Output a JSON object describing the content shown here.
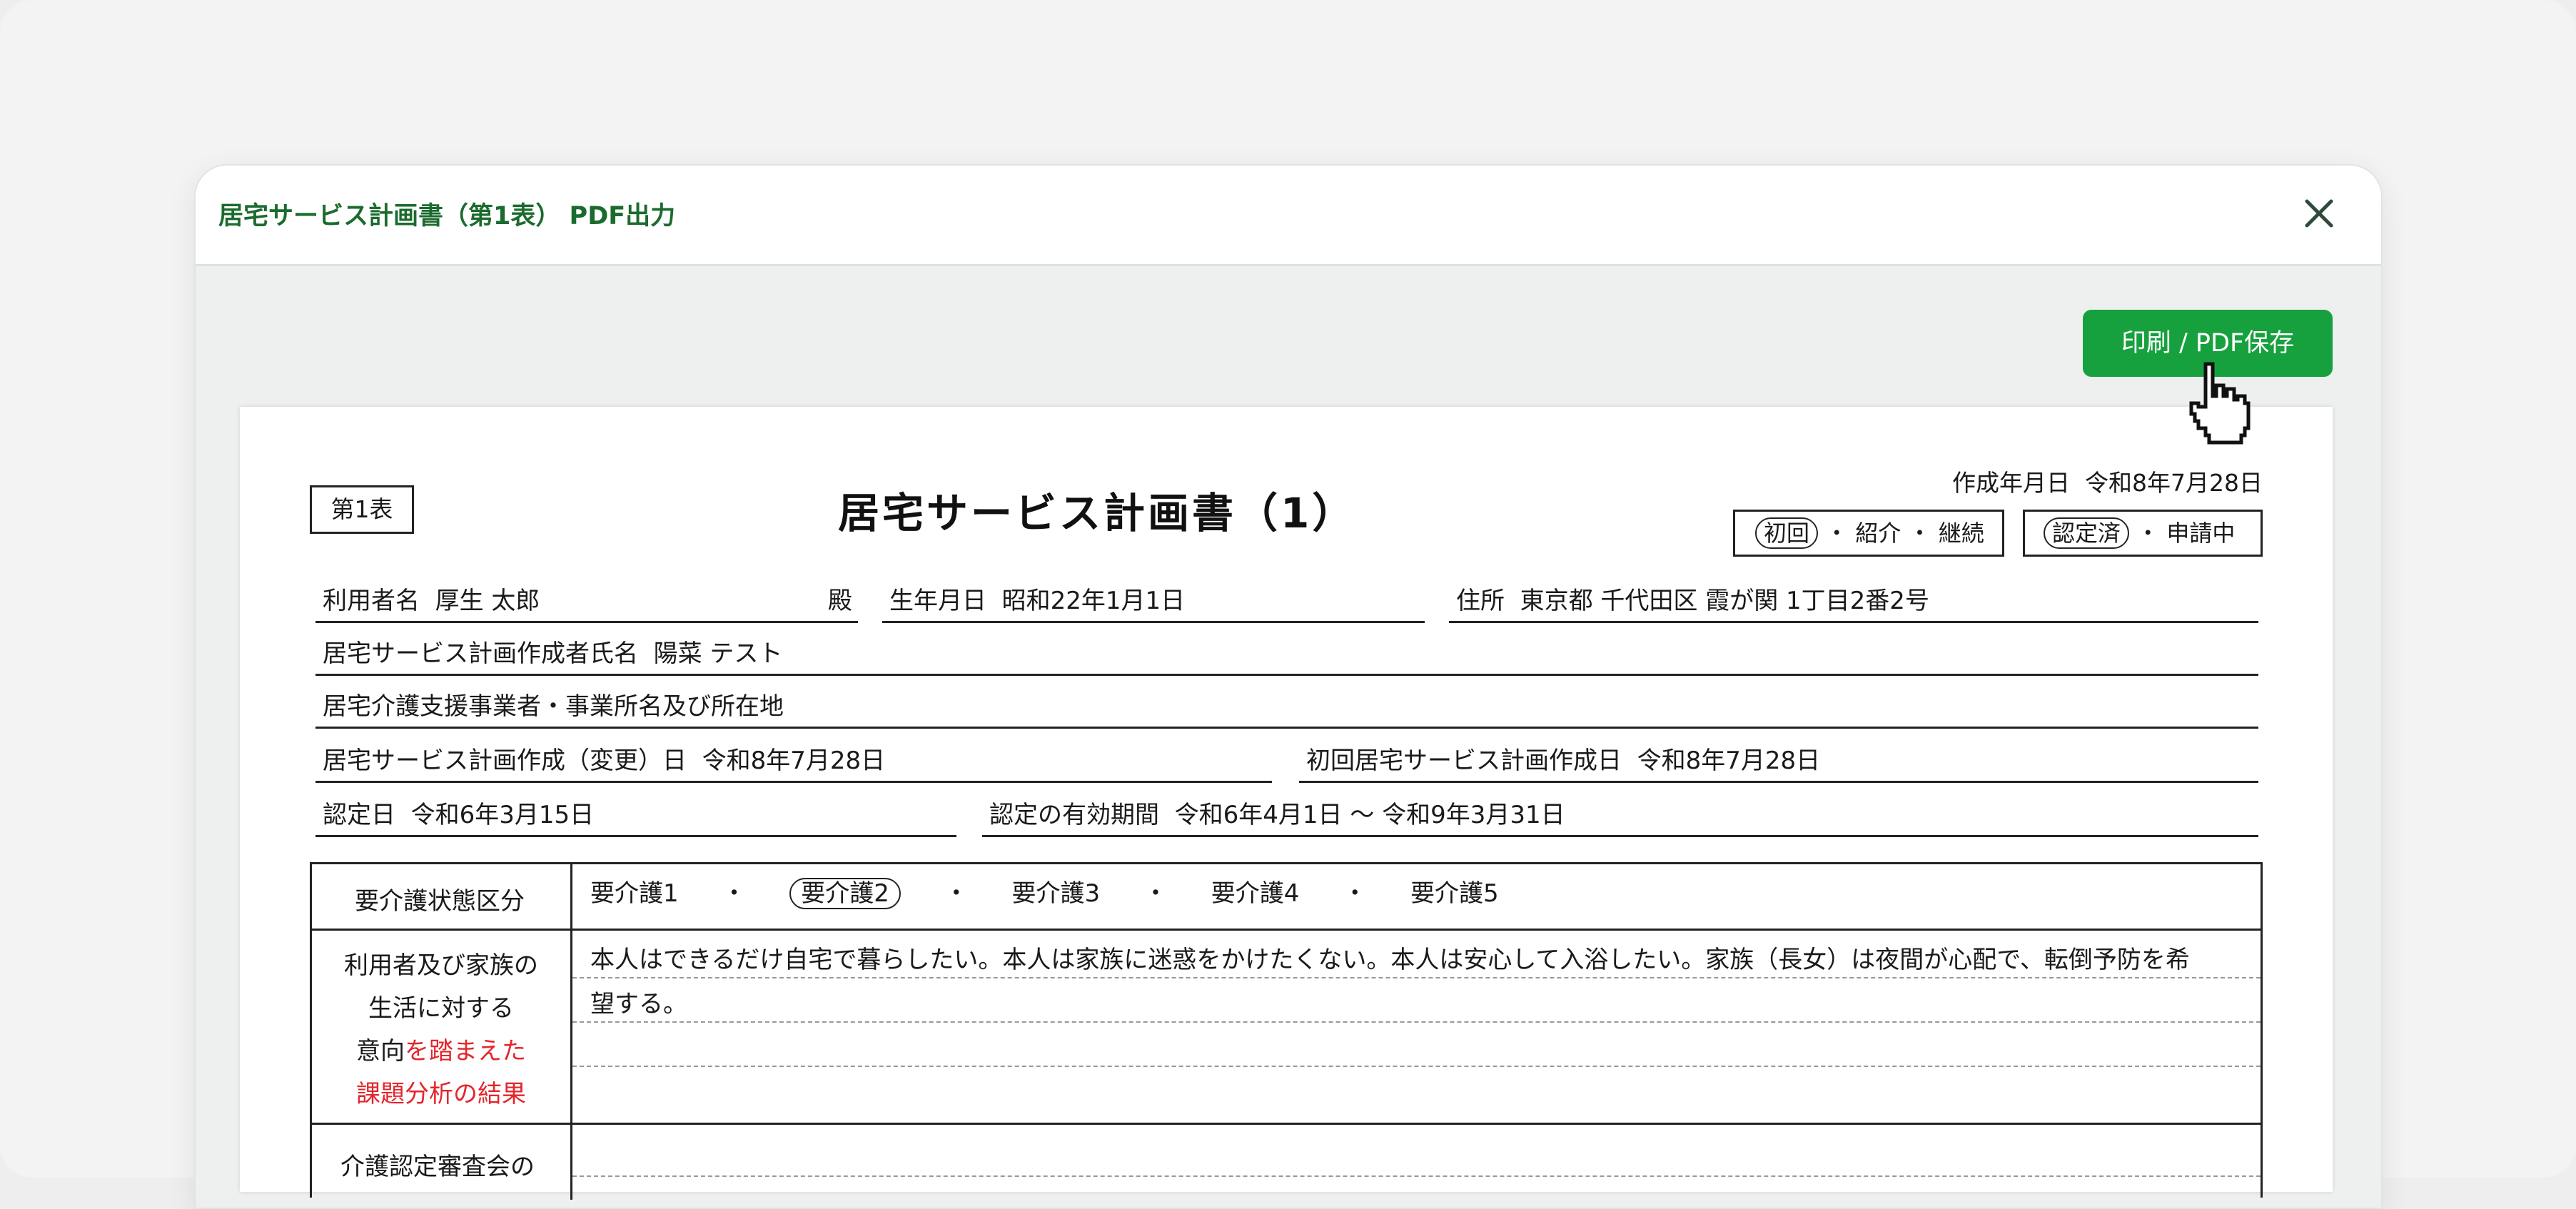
{
  "modal": {
    "title": "居宅サービス計画書（第1表） PDF出力",
    "print_button": "印刷 / PDF保存",
    "accent_color": "#17a13e",
    "title_color": "#1b6b2e"
  },
  "document": {
    "form_number": "第1表",
    "title": "居宅サービス計画書（1）",
    "created_label": "作成年月日",
    "created_value": "令和8年7月28日",
    "plan_type": {
      "selected": "初回",
      "rest": "・ 紹介 ・ 継続"
    },
    "cert_status": {
      "selected": "認定済",
      "rest": "・ 申請中"
    },
    "user_name_label": "利用者名",
    "user_name": "厚生 太郎",
    "honorific": "殿",
    "birthdate_label": "生年月日",
    "birthdate": "昭和22年1月1日",
    "address_label": "住所",
    "address": "東京都 千代田区 霞が関 1丁目2番2号",
    "planner_label": "居宅サービス計画作成者氏名",
    "planner": "陽菜 テスト",
    "office_label": "居宅介護支援事業者・事業所名及び所在地",
    "office": "",
    "plan_date_label": "居宅サービス計画作成（変更）日",
    "plan_date": "令和8年7月28日",
    "first_plan_date_label": "初回居宅サービス計画作成日",
    "first_plan_date": "令和8年7月28日",
    "cert_date_label": "認定日",
    "cert_date": "令和6年3月15日",
    "valid_period_label": "認定の有効期間",
    "valid_period": "令和6年4月1日 〜 令和9年3月31日",
    "care_level_label": "要介護状態区分",
    "care_levels": [
      "要介護1",
      "要介護2",
      "要介護3",
      "要介護4",
      "要介護5"
    ],
    "care_level_selected": "要介護2",
    "separator": "・",
    "intention_label_1": "利用者及び家族の",
    "intention_label_2": "生活に対する",
    "intention_label_3a": "意向",
    "intention_label_3b": "を踏まえた",
    "intention_label_4": "課題分析の結果",
    "intention_text_1": "本人はできるだけ自宅で暮らしたい。本人は家族に迷惑をかけたくない。本人は安心して入浴したい。家族（長女）は夜間が心配で、転倒予防を希",
    "intention_text_2": "望する。",
    "next_row_label": "介護認定審査会の"
  }
}
